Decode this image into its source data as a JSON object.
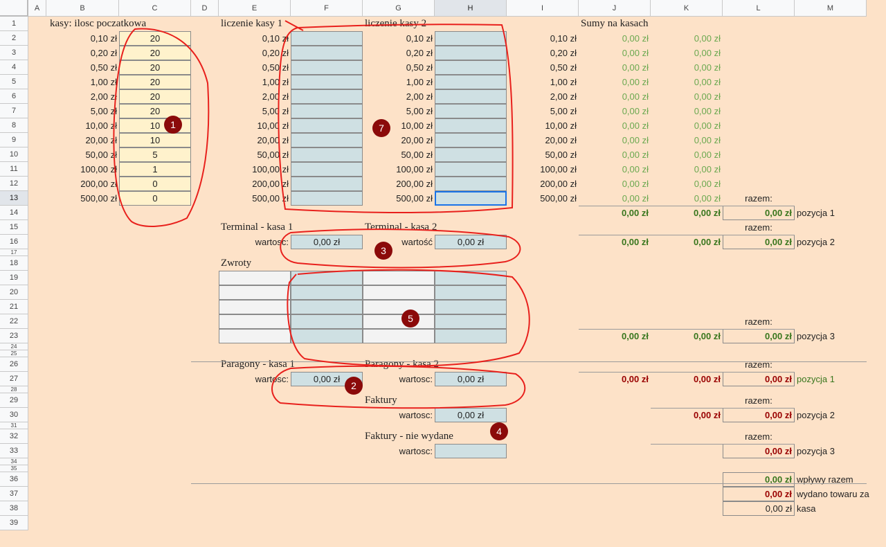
{
  "columns": [
    "A",
    "B",
    "C",
    "D",
    "E",
    "F",
    "G",
    "H",
    "I",
    "J",
    "K",
    "L",
    "M"
  ],
  "rows": [
    "1",
    "2",
    "3",
    "4",
    "5",
    "6",
    "7",
    "8",
    "9",
    "10",
    "11",
    "12",
    "13",
    "14",
    "15",
    "16",
    "17",
    "18",
    "19",
    "20",
    "21",
    "22",
    "23",
    "24",
    "25",
    "26",
    "27",
    "28",
    "29",
    "30",
    "31",
    "32",
    "33",
    "34",
    "35",
    "36",
    "37",
    "38",
    "39"
  ],
  "denominations": [
    "0,10 zł",
    "0,20 zł",
    "0,50 zł",
    "1,00 zł",
    "2,00 zł",
    "5,00 zł",
    "10,00 zł",
    "20,00 zł",
    "50,00 zł",
    "100,00 zł",
    "200,00 zł",
    "500,00 zł"
  ],
  "initial_counts": [
    "20",
    "20",
    "20",
    "20",
    "20",
    "20",
    "10",
    "10",
    "5",
    "1",
    "0",
    "0"
  ],
  "titles": {
    "initial": "kasy: ilosc poczatkowa",
    "count1": "liczenie kasy 1",
    "count2": "liczenie kasy 2",
    "sums": "Sumy na kasach",
    "terminal1": "Terminal - kasa 1",
    "terminal2": "Terminal - kasa 2",
    "returns": "Zwroty",
    "receipts1": "Paragony - kasa 1",
    "receipts2": "Paragony - kasa 2",
    "invoices": "Faktury",
    "invoices_unissued": "Faktury - nie wydane"
  },
  "labels": {
    "wartosc": "wartosc:",
    "wartosc_accent": "wartość",
    "razem": "razem:",
    "pos1": "pozycja 1",
    "pos2": "pozycja 2",
    "pos3": "pozycja 3",
    "inflows": "wpływy razem",
    "goods": "wydano towaru za",
    "cash": "kasa"
  },
  "zero": "0,00 zł",
  "badges": [
    "1",
    "7",
    "3",
    "5",
    "2",
    "4"
  ]
}
